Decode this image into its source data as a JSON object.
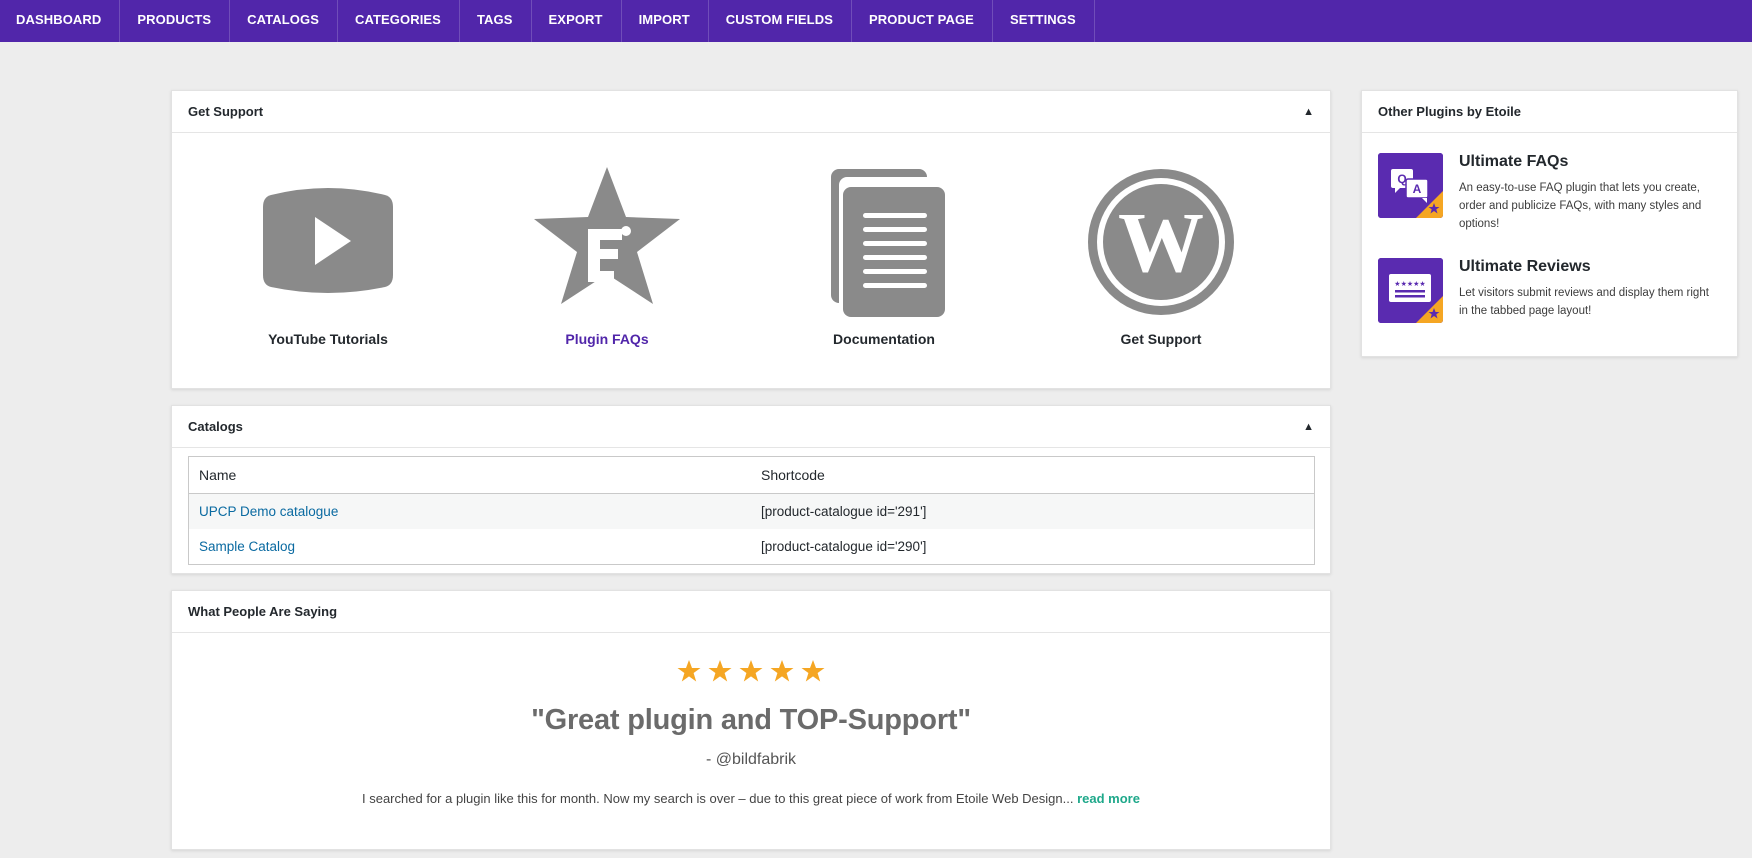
{
  "nav": {
    "items": [
      "DASHBOARD",
      "PRODUCTS",
      "CATALOGS",
      "CATEGORIES",
      "TAGS",
      "EXPORT",
      "IMPORT",
      "CUSTOM FIELDS",
      "PRODUCT PAGE",
      "SETTINGS"
    ]
  },
  "colors": {
    "brand": "#5126aa",
    "link": "#0a6aa1",
    "star": "#f5a623",
    "read_more": "#1ea88a"
  },
  "support": {
    "title": "Get Support",
    "toggle": "▲",
    "items": [
      {
        "label": "YouTube Tutorials",
        "icon": "youtube-icon"
      },
      {
        "label": "Plugin FAQs",
        "icon": "faq-star-icon"
      },
      {
        "label": "Documentation",
        "icon": "documentation-icon"
      },
      {
        "label": "Get Support",
        "icon": "wordpress-icon"
      }
    ]
  },
  "catalogs": {
    "title": "Catalogs",
    "toggle": "▲",
    "columns": [
      "Name",
      "Shortcode"
    ],
    "rows": [
      {
        "name": "UPCP Demo catalogue",
        "shortcode": "[product-catalogue id='291']"
      },
      {
        "name": "Sample Catalog",
        "shortcode": "[product-catalogue id='290']"
      }
    ]
  },
  "reviews": {
    "title": "What People Are Saying",
    "rating": 5,
    "quote": "\"Great plugin and TOP-Support\"",
    "author": "- @bildfabrik",
    "excerpt": "I searched for a plugin like this for month. Now my search is over – due to this great piece of work from Etoile Web Design...",
    "read_more": "read more"
  },
  "plugins": {
    "title": "Other Plugins by Etoile",
    "items": [
      {
        "name": "Ultimate FAQs",
        "description": "An easy-to-use FAQ plugin that lets you create, order and publicize FAQs, with many styles and options!",
        "icon": "faq-plugin-icon"
      },
      {
        "name": "Ultimate Reviews",
        "description": "Let visitors submit reviews and display them right in the tabbed page layout!",
        "icon": "reviews-plugin-icon"
      }
    ]
  }
}
